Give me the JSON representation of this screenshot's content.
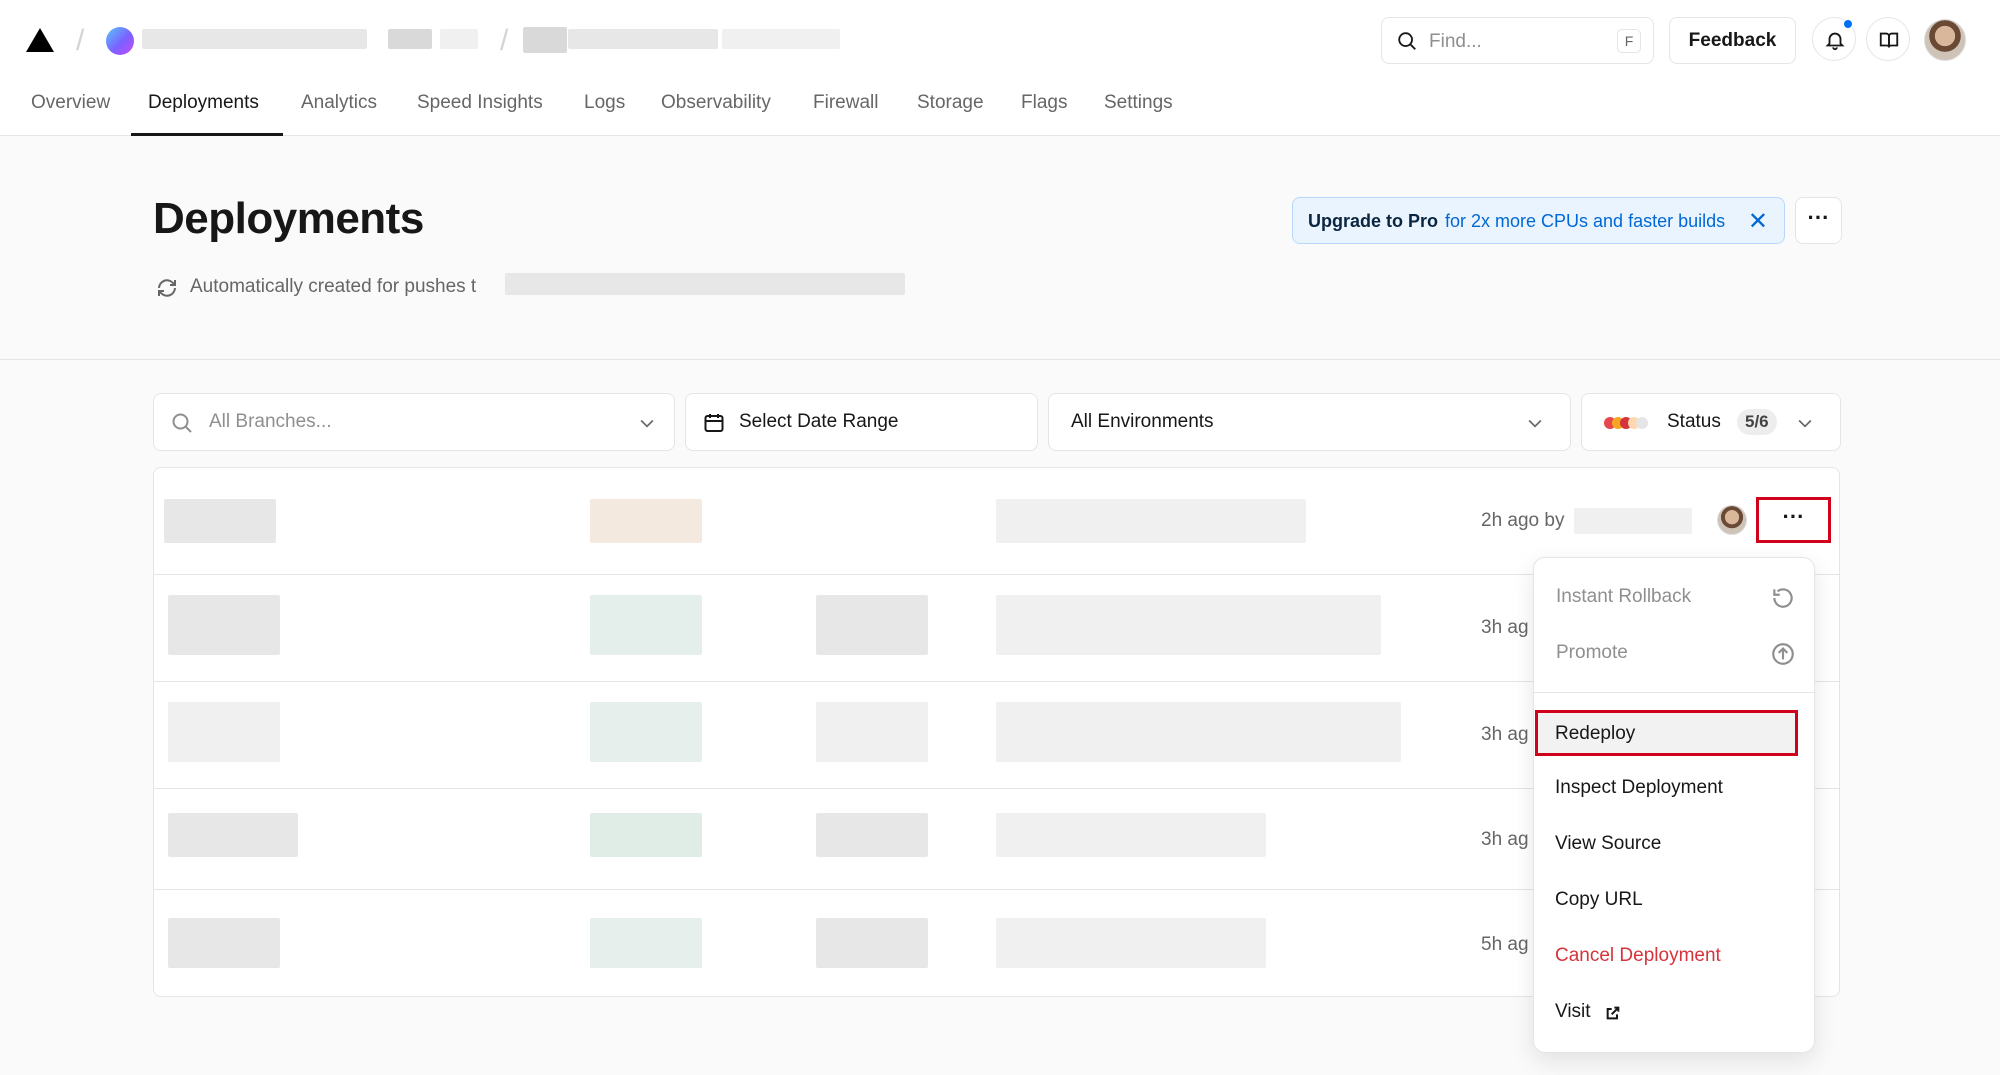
{
  "header": {
    "find_placeholder": "Find...",
    "find_shortcut": "F",
    "feedback_label": "Feedback"
  },
  "tabs": [
    {
      "label": "Overview"
    },
    {
      "label": "Deployments",
      "active": true
    },
    {
      "label": "Analytics"
    },
    {
      "label": "Speed Insights"
    },
    {
      "label": "Logs"
    },
    {
      "label": "Observability"
    },
    {
      "label": "Firewall"
    },
    {
      "label": "Storage"
    },
    {
      "label": "Flags"
    },
    {
      "label": "Settings"
    }
  ],
  "page": {
    "title": "Deployments",
    "subtitle": "Automatically created for pushes t",
    "upgrade_bold": "Upgrade to Pro",
    "upgrade_rest": "for 2x more CPUs and faster builds",
    "upgrade_close": "✕",
    "more": "···"
  },
  "filters": {
    "branches_placeholder": "All Branches...",
    "date_range": "Select Date Range",
    "environments": "All Environments",
    "status_label": "Status",
    "status_count": "5/6",
    "status_colors": [
      "#e5484d",
      "#f5a623",
      "#d6343a",
      "#ffd8b0",
      "#e5e5e5"
    ]
  },
  "rows": [
    {
      "time": "2h ago by"
    },
    {
      "time": "3h ag"
    },
    {
      "time": "3h ag"
    },
    {
      "time": "3h ag"
    },
    {
      "time": "5h ag"
    }
  ],
  "row_more": "···",
  "menu": {
    "items": [
      {
        "label": "Instant Rollback",
        "icon": "rollback-icon",
        "state": "disabled"
      },
      {
        "label": "Promote",
        "icon": "promote-icon",
        "state": "disabled"
      },
      {
        "label": "Redeploy",
        "state": "highlighted"
      },
      {
        "label": "Inspect Deployment"
      },
      {
        "label": "View Source"
      },
      {
        "label": "Copy URL"
      },
      {
        "label": "Cancel Deployment",
        "state": "danger"
      },
      {
        "label": "Visit",
        "icon": "external-link-icon"
      }
    ]
  },
  "colors": {
    "accent_blue": "#0070f3",
    "danger_red": "#d6343a",
    "highlight_box": "#d0021b"
  }
}
